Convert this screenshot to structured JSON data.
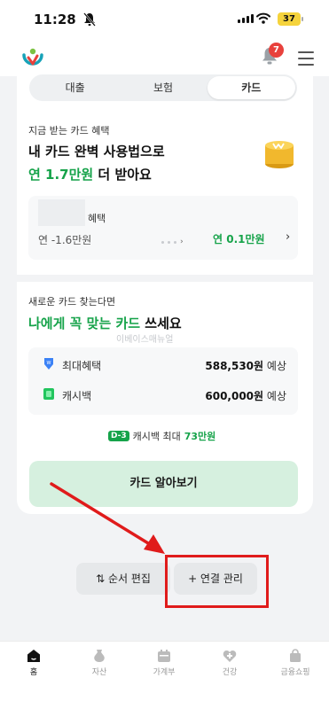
{
  "status_bar": {
    "time": "11:28",
    "battery": "37"
  },
  "header": {
    "notification_count": "7"
  },
  "segmented": {
    "tabs": [
      "대출",
      "보험",
      "카드"
    ],
    "active_index": 2
  },
  "card_benefit": {
    "subtitle": "지금 받는 카드 혜택",
    "title_line1": "내 카드 완벽 사용법으로",
    "title_line2_highlight": "연 1.7만원",
    "title_line2_rest": " 더 받아요",
    "benefit_label": "혜택",
    "current_value": "연 -1.6만원",
    "target_value": "연 0.1만원"
  },
  "new_card": {
    "subtitle": "새로운 카드 찾는다면",
    "title_highlight": "나에게 꼭 맞는 카드",
    "title_rest": " 쓰세요",
    "watermark": "이베이스매뉴얼",
    "rows": [
      {
        "label": "최대혜택",
        "amount": "588,530원",
        "suffix": "예상"
      },
      {
        "label": "캐시백",
        "amount": "600,000원",
        "suffix": "예상"
      }
    ],
    "promo_badge": "D-3",
    "promo_text": "캐시백 최대",
    "promo_amount": "73만원",
    "cta_label": "카드 알아보기"
  },
  "bottom_buttons": {
    "reorder_label": "순서 편집",
    "link_label": "+ 연결 관리"
  },
  "tab_bar": {
    "items": [
      {
        "label": "홈",
        "icon": "home-icon",
        "active": true
      },
      {
        "label": "자산",
        "icon": "asset-icon",
        "active": false
      },
      {
        "label": "가계부",
        "icon": "calendar-icon",
        "active": false
      },
      {
        "label": "건강",
        "icon": "health-icon",
        "active": false
      },
      {
        "label": "금융쇼핑",
        "icon": "shopping-bag-icon",
        "active": false
      }
    ]
  },
  "colors": {
    "accent_green": "#16a34a",
    "highlight_red": "#e01b1b",
    "cta_bg": "#d6f0df",
    "badge_red": "#e8413c"
  }
}
